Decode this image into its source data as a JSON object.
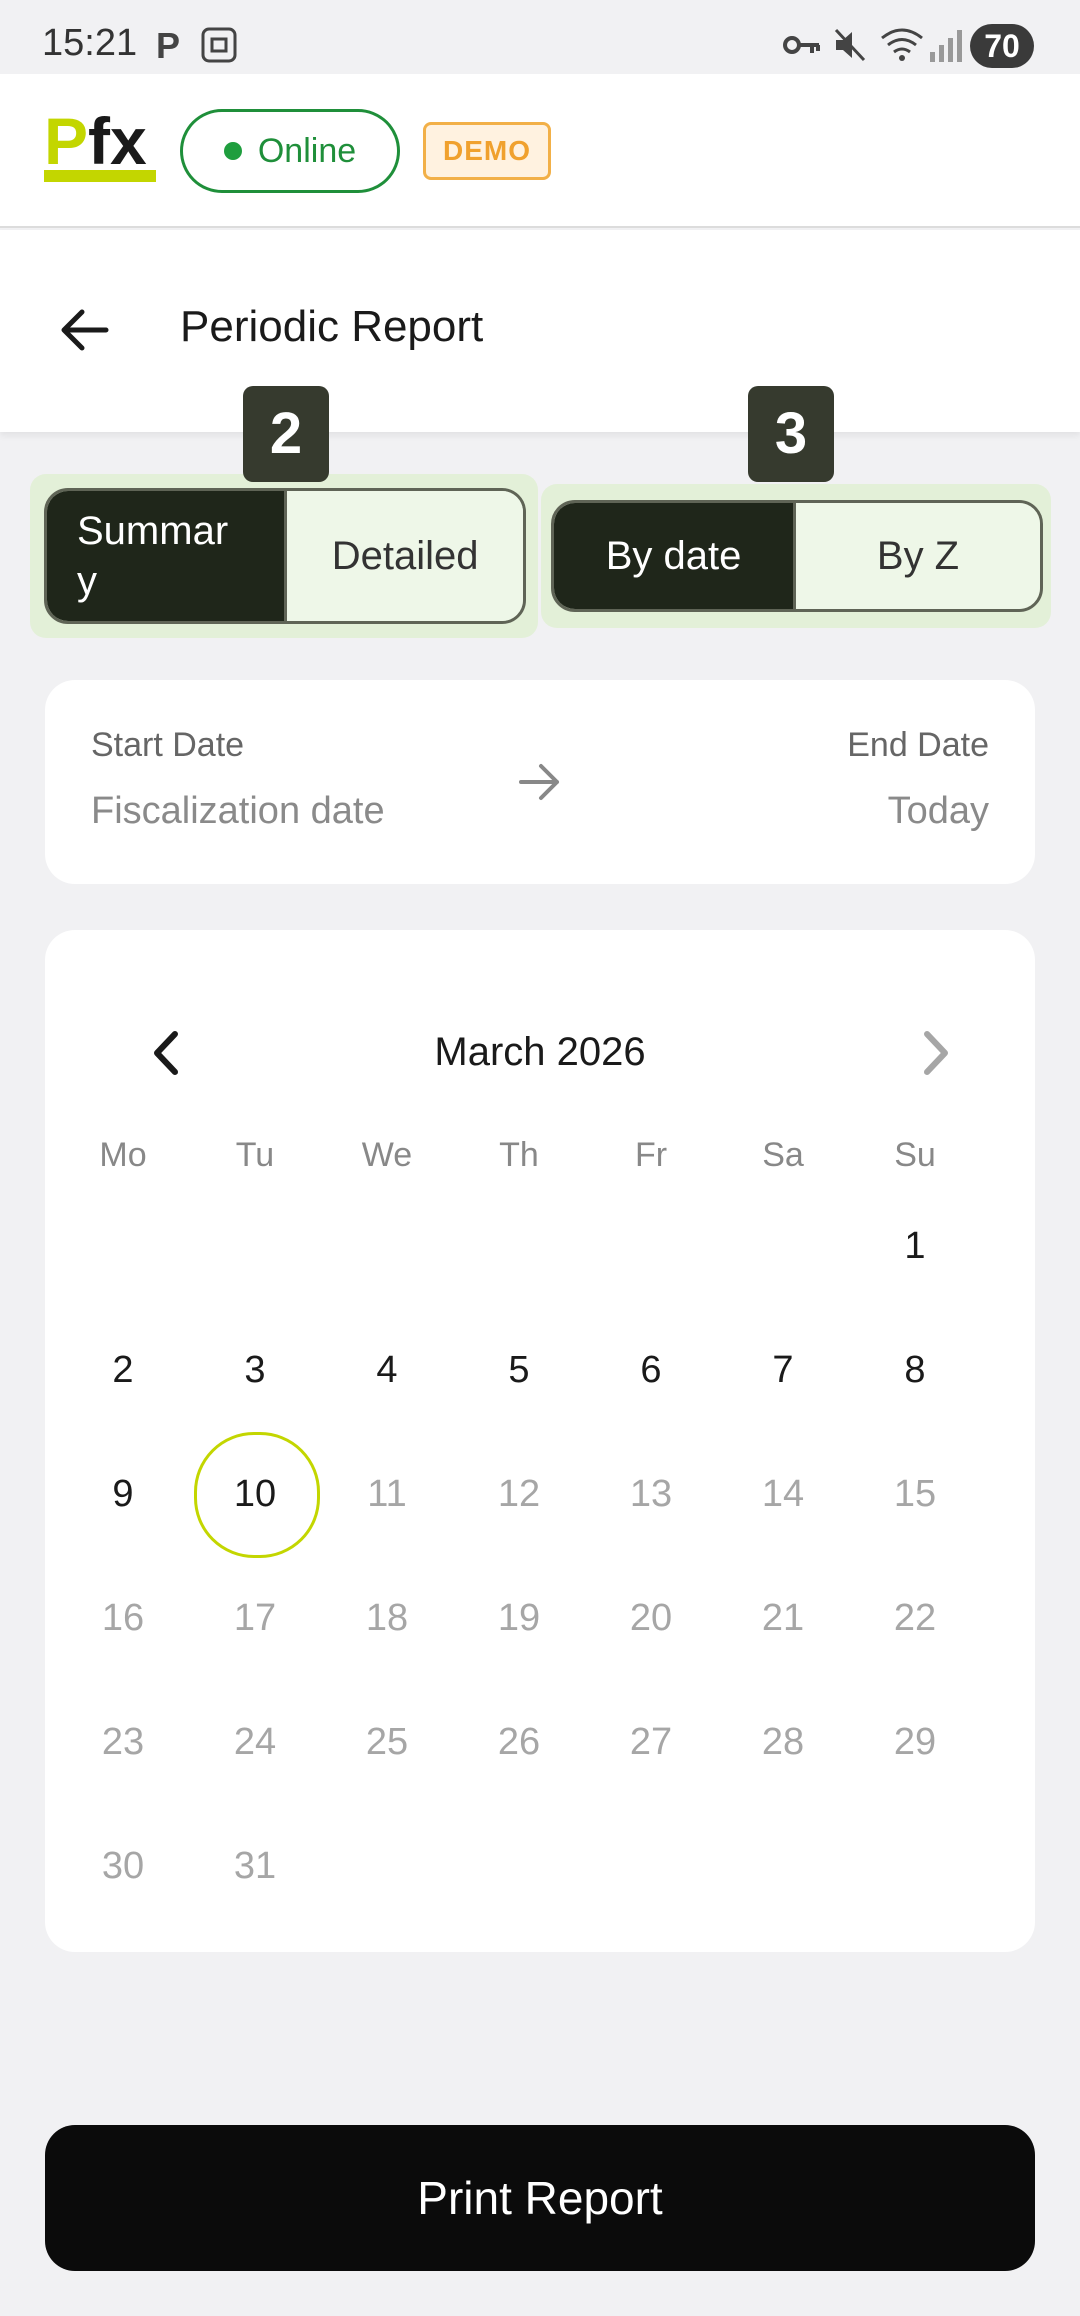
{
  "status_bar": {
    "time": "15:21",
    "battery": "70",
    "icons": [
      "parking-icon",
      "screenshot-icon",
      "vpn-key-icon",
      "mute-icon",
      "wifi-icon",
      "signal-icon"
    ]
  },
  "app_bar": {
    "logo_p": "P",
    "logo_fx": "fx",
    "online_label": "Online",
    "demo_label": "DEMO",
    "colors": {
      "brand": "#c3d600",
      "online": "#1f8f3a",
      "demo": "#f0a12e"
    }
  },
  "header": {
    "title": "Periodic Report"
  },
  "badges": {
    "first": "2",
    "second": "3"
  },
  "report_type": {
    "options": [
      "Summar\ny",
      "Detailed"
    ],
    "selected": "Summar y"
  },
  "range_type": {
    "options": [
      "By date",
      "By Z"
    ],
    "selected": "By date"
  },
  "date_range": {
    "start_label": "Start Date",
    "start_value": "Fiscalization date",
    "end_label": "End Date",
    "end_value": "Today"
  },
  "calendar": {
    "month_title": "March 2026",
    "weekdays": [
      "Mo",
      "Tu",
      "We",
      "Th",
      "Fr",
      "Sa",
      "Su"
    ],
    "first_weekday_index": 6,
    "days_in_month": 31,
    "today": 10,
    "last_enabled_day": 10
  },
  "print_button": {
    "label": "Print Report"
  }
}
